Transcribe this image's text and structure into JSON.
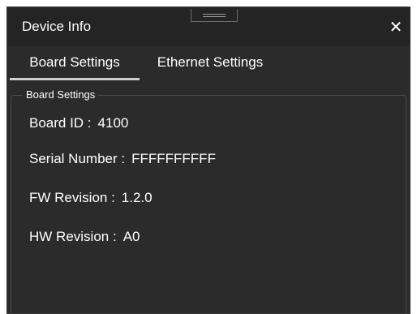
{
  "window": {
    "title": "Device Info",
    "close_icon": "close-icon",
    "drag_icon": "drag-handle-icon"
  },
  "tabs": [
    {
      "label": "Board Settings",
      "active": true
    },
    {
      "label": "Ethernet Settings",
      "active": false
    }
  ],
  "board_settings": {
    "group_title": "Board Settings",
    "fields": [
      {
        "label": "Board ID :",
        "value": "4100"
      },
      {
        "label": "Serial Number :",
        "value": "FFFFFFFFFF"
      },
      {
        "label": "FW Revision :",
        "value": "1.2.0"
      },
      {
        "label": "HW Revision :",
        "value": "A0"
      }
    ]
  },
  "colors": {
    "window_bg": "#2b2b2b",
    "titlebar_bg": "#242424",
    "text": "#ffffff",
    "tab_indicator": "#d0d0d0",
    "group_border": "#4e4e4e"
  }
}
